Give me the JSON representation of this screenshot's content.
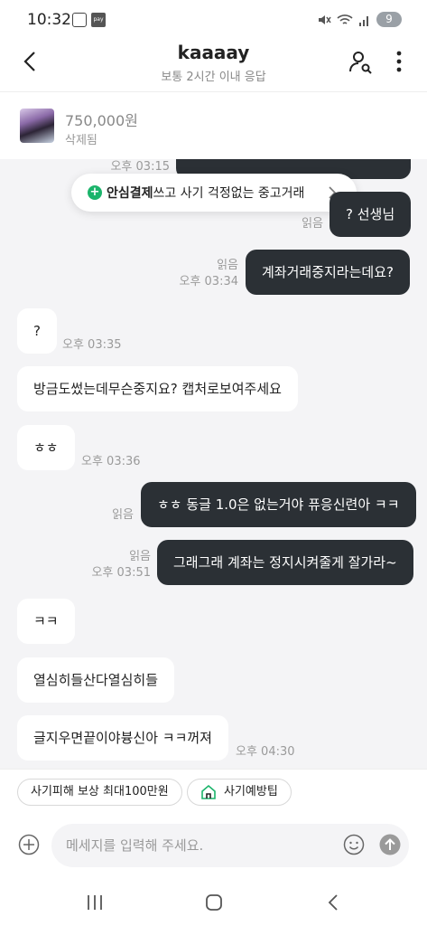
{
  "status_bar": {
    "time": "10:32",
    "pay_label": "pay",
    "battery": "9"
  },
  "header": {
    "title": "kaaaay",
    "subtitle": "보통 2시간 이내 응답"
  },
  "product": {
    "price": "750,000원",
    "status": "삭제됨"
  },
  "banner": {
    "bold": "안심결제",
    "text": "쓰고 사기 걱정없는 중고거래"
  },
  "messages": [
    {
      "side": "mine",
      "text": "",
      "time": "오후 03:15",
      "read": ""
    },
    {
      "side": "mine",
      "text": "? 선생님",
      "read": "읽음",
      "time": ""
    },
    {
      "side": "mine",
      "text": "계좌거래중지라는데요?",
      "read": "읽음",
      "time": "오후 03:34"
    },
    {
      "side": "theirs",
      "text": "?",
      "time": "오후 03:35"
    },
    {
      "side": "theirs",
      "text": "방금도썼는데무슨중지요? 캡처로보여주세요",
      "time": ""
    },
    {
      "side": "theirs",
      "text": "ㅎㅎ",
      "time": "오후 03:36"
    },
    {
      "side": "mine",
      "text": "ㅎㅎ 동글 1.0은 없는거야 퓨응신련아 ㅋㅋ",
      "read": "읽음",
      "time": ""
    },
    {
      "side": "mine",
      "text": "그래그래 계좌는 정지시켜줄게 잘가라~",
      "read": "읽음",
      "time": "오후 03:51"
    },
    {
      "side": "theirs",
      "text": "ㅋㅋ",
      "time": ""
    },
    {
      "side": "theirs",
      "text": "열심히들산다열심히들",
      "time": ""
    },
    {
      "side": "theirs",
      "text": "글지우면끝이야븅신아 ㅋㅋ꺼져",
      "time": "오후 04:30"
    }
  ],
  "chips": [
    {
      "label": "사기피해 보상 최대100만원"
    },
    {
      "label": "사기예방팁",
      "icon": "house-shield-icon"
    }
  ],
  "input": {
    "placeholder": "메세지를 입력해 주세요."
  },
  "colors": {
    "my_bubble": "#2b3035",
    "chat_bg": "#f4f4f6",
    "accent_green": "#1bb46b"
  }
}
